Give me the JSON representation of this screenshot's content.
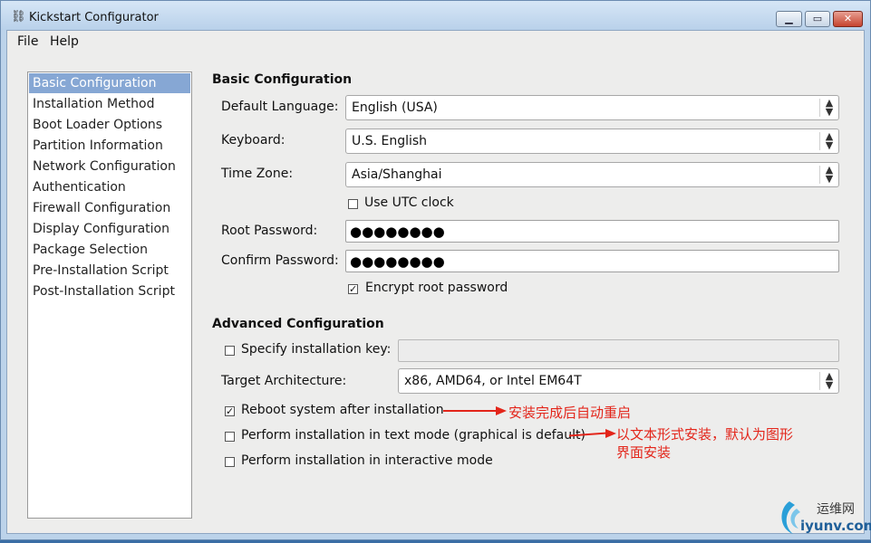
{
  "window": {
    "title": "Kickstart Configurator"
  },
  "menu": {
    "file": "File",
    "help": "Help"
  },
  "sidebar": {
    "items": [
      {
        "label": "Basic Configuration",
        "selected": true
      },
      {
        "label": "Installation Method"
      },
      {
        "label": "Boot Loader Options"
      },
      {
        "label": "Partition Information"
      },
      {
        "label": "Network Configuration"
      },
      {
        "label": "Authentication"
      },
      {
        "label": "Firewall Configuration"
      },
      {
        "label": "Display Configuration"
      },
      {
        "label": "Package Selection"
      },
      {
        "label": "Pre-Installation Script"
      },
      {
        "label": "Post-Installation Script"
      }
    ]
  },
  "basic": {
    "title": "Basic Configuration",
    "language_label": "Default Language:",
    "language_value": "English (USA)",
    "keyboard_label": "Keyboard:",
    "keyboard_value": "U.S. English",
    "timezone_label": "Time Zone:",
    "timezone_value": "Asia/Shanghai",
    "utc_label": "Use UTC clock",
    "utc_checked": false,
    "root_pw_label": "Root Password:",
    "root_pw_value": "●●●●●●●●",
    "confirm_pw_label": "Confirm Password:",
    "confirm_pw_value": "●●●●●●●●",
    "encrypt_label": "Encrypt root password",
    "encrypt_checked": true
  },
  "advanced": {
    "title": "Advanced Configuration",
    "install_key_label": "Specify installation key:",
    "install_key_checked": false,
    "install_key_value": "",
    "arch_label": "Target Architecture:",
    "arch_value": "x86, AMD64, or Intel EM64T",
    "reboot_label": "Reboot system after installation",
    "reboot_checked": true,
    "text_mode_label": "Perform installation in text mode (graphical is default)",
    "text_mode_checked": false,
    "interactive_label": "Perform installation in interactive mode",
    "interactive_checked": false
  },
  "annotations": {
    "reboot_note": "安装完成后自动重启",
    "text_mode_note_line1": "以文本形式安装，默认为图形",
    "text_mode_note_line2": "界面安装",
    "color": "#e3251a"
  },
  "watermark": {
    "text_cn": "运维网",
    "text_en": "iyunv.com"
  },
  "icons": {
    "check": "✓",
    "combo_arrow": "⬍"
  }
}
